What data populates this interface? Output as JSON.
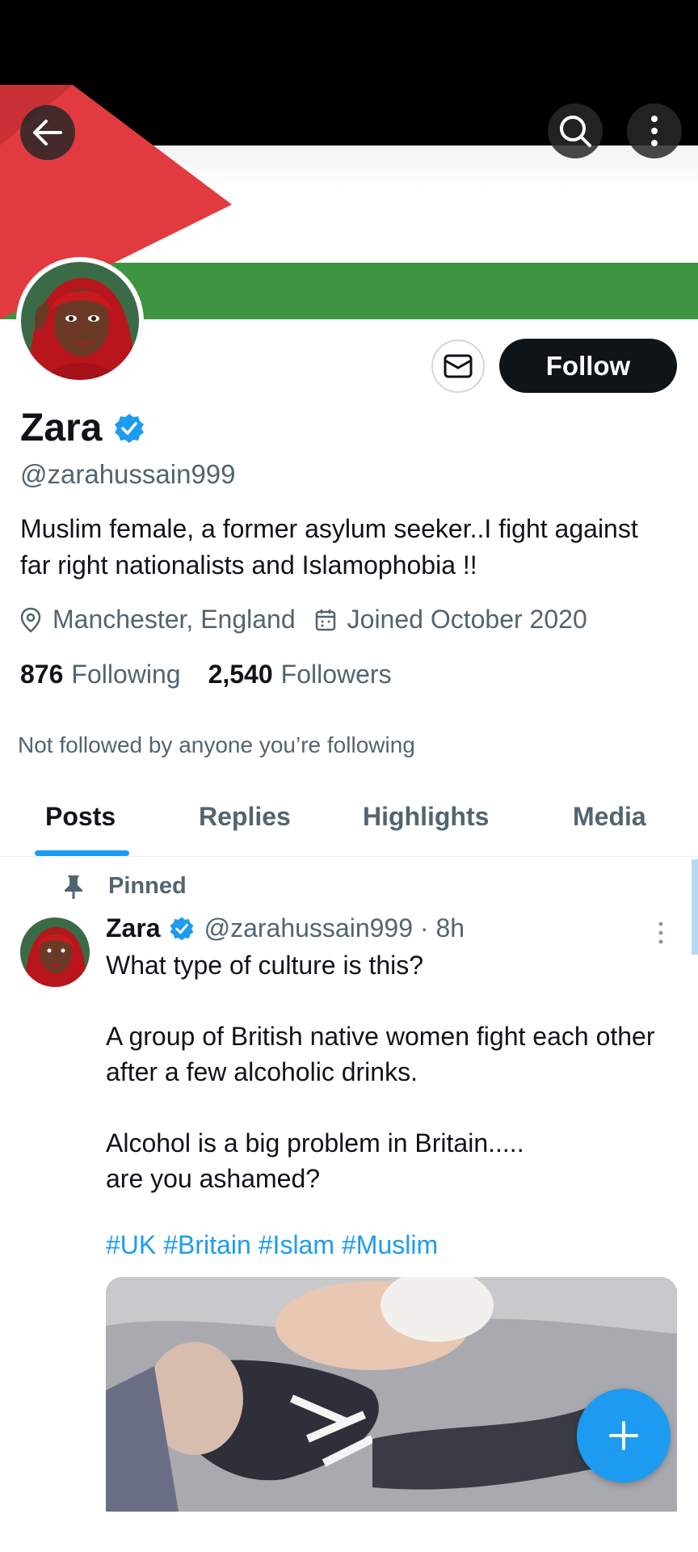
{
  "profile": {
    "name": "Zara",
    "handle": "@zarahussain999",
    "bio": "Muslim female, a former asylum seeker..I fight against far right nationalists and Islamophobia !!",
    "location": "Manchester, England",
    "joined": "Joined October 2020",
    "following_count": "876",
    "following_label": "Following",
    "followers_count": "2,540",
    "followers_label": "Followers",
    "not_followed_note": "Not followed by anyone you’re following"
  },
  "actions": {
    "follow_label": "Follow",
    "message_icon": "envelope-icon"
  },
  "header_icons": [
    "back-arrow-icon",
    "search-icon",
    "more-vertical-icon"
  ],
  "tabs": [
    {
      "label": "Posts",
      "active": true
    },
    {
      "label": "Replies",
      "active": false
    },
    {
      "label": "Highlights",
      "active": false
    },
    {
      "label": "Media",
      "active": false
    }
  ],
  "pinned_post": {
    "pinned_label": "Pinned",
    "author_name": "Zara",
    "author_handle_time": "@zarahussain999 · 8h",
    "text_lines": [
      "What type of culture is this?",
      "",
      "A group of British native women fight each other after a few alcoholic drinks.",
      "",
      "Alcohol is a big problem in Britain.....",
      "are you ashamed?"
    ],
    "hashtags": [
      "#UK",
      "#Britain",
      "#Islam",
      "#Muslim"
    ]
  },
  "colors": {
    "accent": "#1d9bf0",
    "text_primary": "#0f1419",
    "text_secondary": "#536471",
    "follow_button_bg": "#0f1419",
    "flag_red": "#e23b3f",
    "flag_green": "#3f9441"
  }
}
